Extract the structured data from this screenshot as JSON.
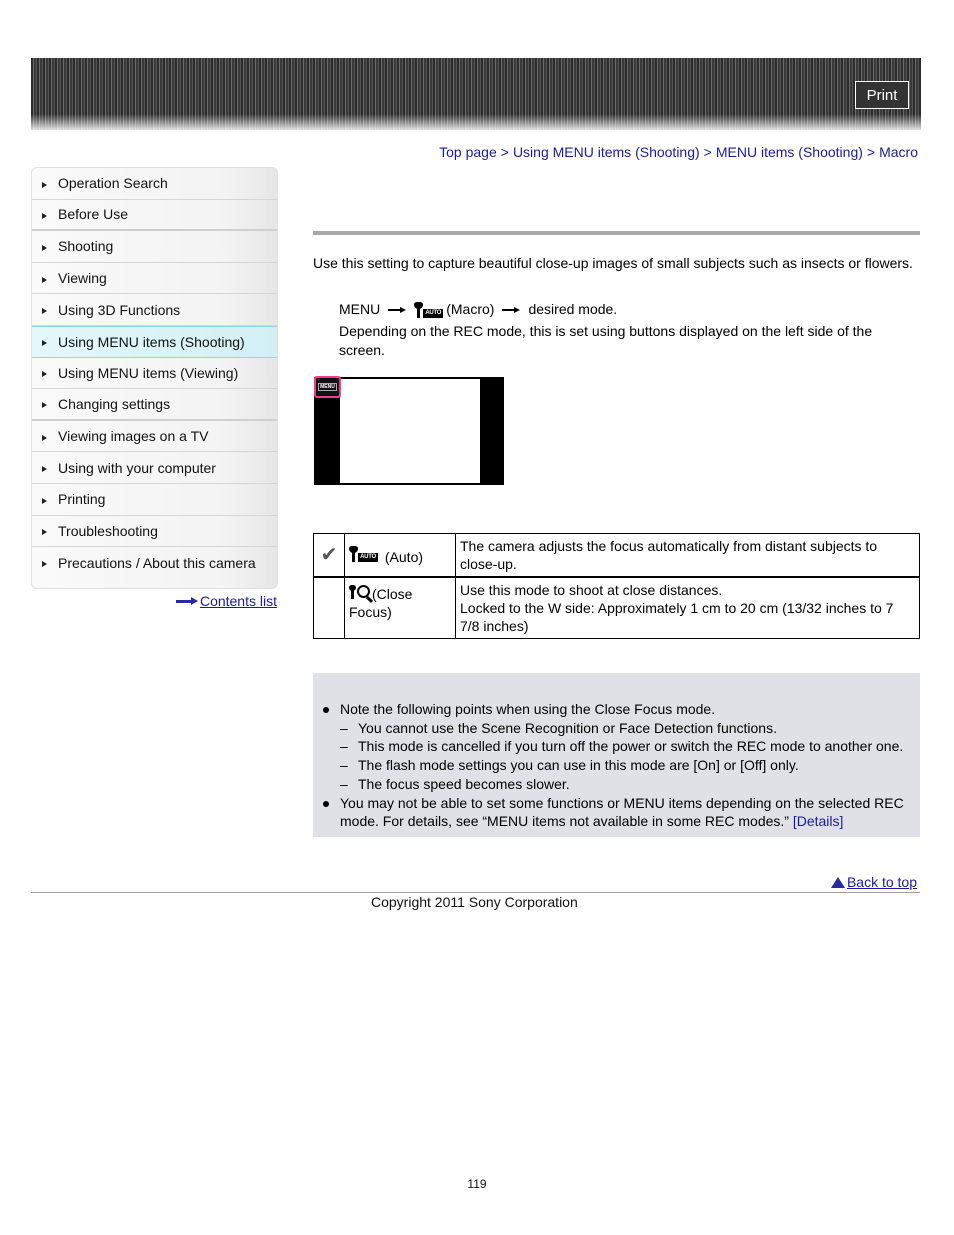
{
  "header": {
    "print_label": "Print"
  },
  "breadcrumb": {
    "items": [
      "Top page",
      "Using MENU items (Shooting)",
      "MENU items (Shooting)",
      "Macro"
    ],
    "separator": ">"
  },
  "sidebar": {
    "items": [
      {
        "label": "Operation Search"
      },
      {
        "label": "Before Use"
      },
      {
        "label": "Shooting"
      },
      {
        "label": "Viewing"
      },
      {
        "label": "Using 3D Functions"
      },
      {
        "label": "Using MENU items (Shooting)",
        "active": true
      },
      {
        "label": "Using MENU items (Viewing)"
      },
      {
        "label": "Changing settings"
      },
      {
        "label": "Viewing images on a TV"
      },
      {
        "label": "Using with your computer"
      },
      {
        "label": "Printing"
      },
      {
        "label": "Troubleshooting"
      },
      {
        "label": "Precautions / About this camera"
      }
    ],
    "contents_link": "Contents list"
  },
  "main": {
    "intro": "Use this setting to capture beautiful close-up images of small subjects such as insects or flowers.",
    "step": {
      "menu": "MENU",
      "icon": "macro-auto-icon",
      "icon_text": "AUTO",
      "item": "(Macro)",
      "result": "desired mode.",
      "note": "Depending on the REC mode, this is set using buttons displayed on the left side of the screen."
    },
    "figure": {
      "menu_button_label": "MENU"
    },
    "modes": [
      {
        "default": true,
        "icon": "macro-auto-icon",
        "icon_text": "AUTO",
        "name": "(Auto)",
        "description": [
          "The camera adjusts the focus automatically from distant subjects to close-up."
        ]
      },
      {
        "default": false,
        "icon": "close-focus-icon",
        "name": "(Close Focus)",
        "description": [
          "Use this mode to shoot at close distances.",
          "Locked to the W side: Approximately 1 cm to 20 cm (13/32 inches to 7 7/8 inches)"
        ]
      }
    ],
    "notes": {
      "bullet1": "Note the following points when using the Close Focus mode.",
      "sub_items": [
        "You cannot use the Scene Recognition or Face Detection functions.",
        "This mode is cancelled if you turn off the power or switch the REC mode to another one.",
        "The flash mode settings you can use in this mode are [On] or [Off] only.",
        "The focus speed becomes slower."
      ],
      "bullet2": "You may not be able to set some functions or MENU items depending on the selected REC mode. For details, see “MENU items not available in some REC modes.”",
      "details_link": "[Details]"
    }
  },
  "footer": {
    "back_to_top": "Back to top",
    "copyright": "Copyright 2011 Sony Corporation",
    "page_number": "119"
  }
}
